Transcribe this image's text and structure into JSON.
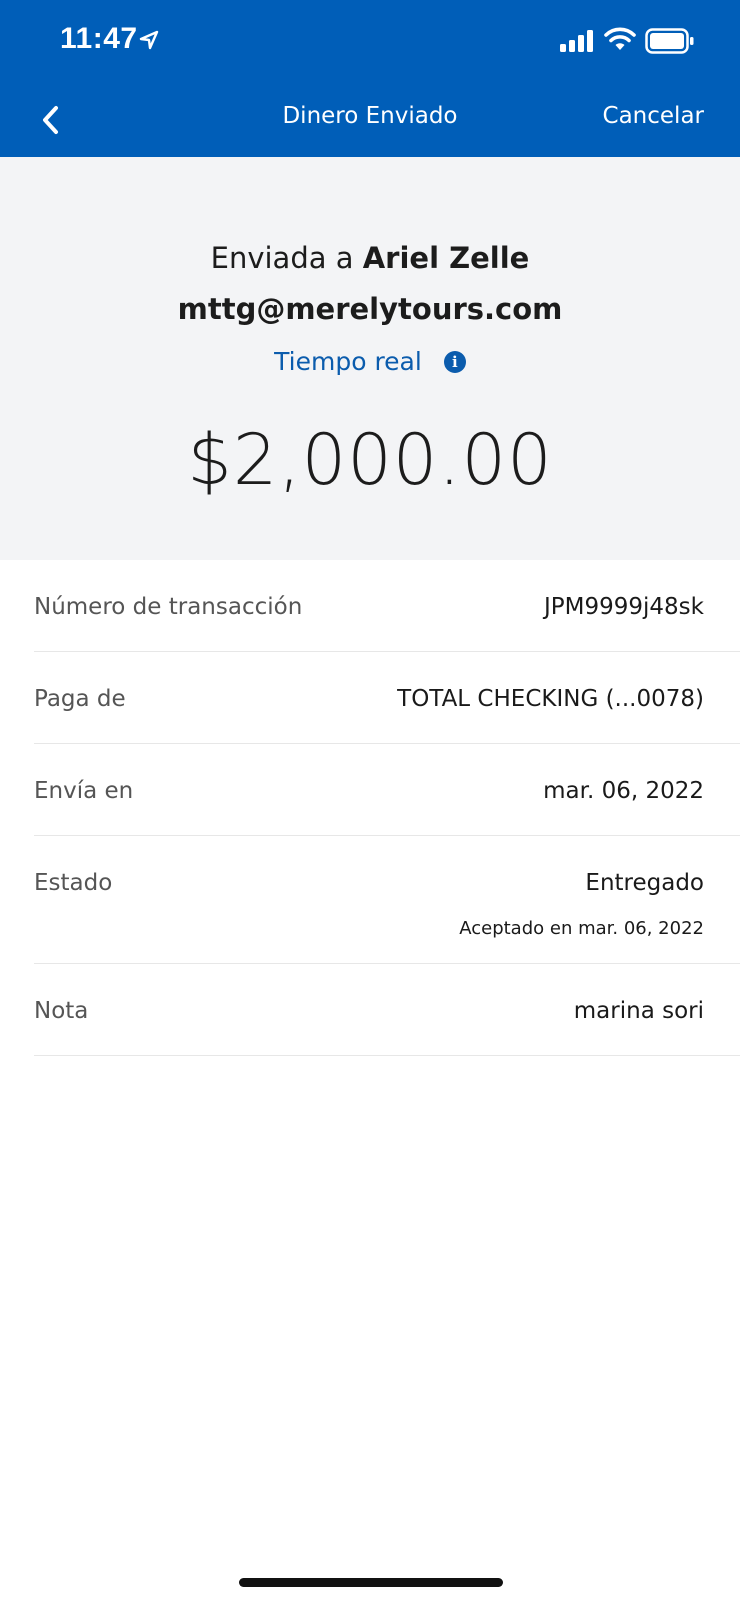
{
  "status_bar": {
    "time": "11:47"
  },
  "nav": {
    "title": "Dinero Enviado",
    "cancel_label": "Cancelar"
  },
  "summary": {
    "sent_to_prefix": "Enviada a ",
    "recipient_name": "Ariel Zelle",
    "recipient_email": "mttg@merelytours.com",
    "delivery_speed": "Tiempo real",
    "amount": "$2,000.00"
  },
  "details": [
    {
      "label": "Número de transacción",
      "value": "JPM9999j48sk"
    },
    {
      "label": "Paga de",
      "value": "TOTAL CHECKING (...0078)"
    },
    {
      "label": "Envía en",
      "value": "mar. 06, 2022"
    },
    {
      "label": "Estado",
      "value": "Entregado",
      "subvalue": "Aceptado en mar. 06, 2022"
    },
    {
      "label": "Nota",
      "value": "marina sori"
    }
  ],
  "colors": {
    "header_blue": "#005eb8",
    "link_blue": "#0b5cad",
    "summary_bg": "#f3f4f6"
  }
}
